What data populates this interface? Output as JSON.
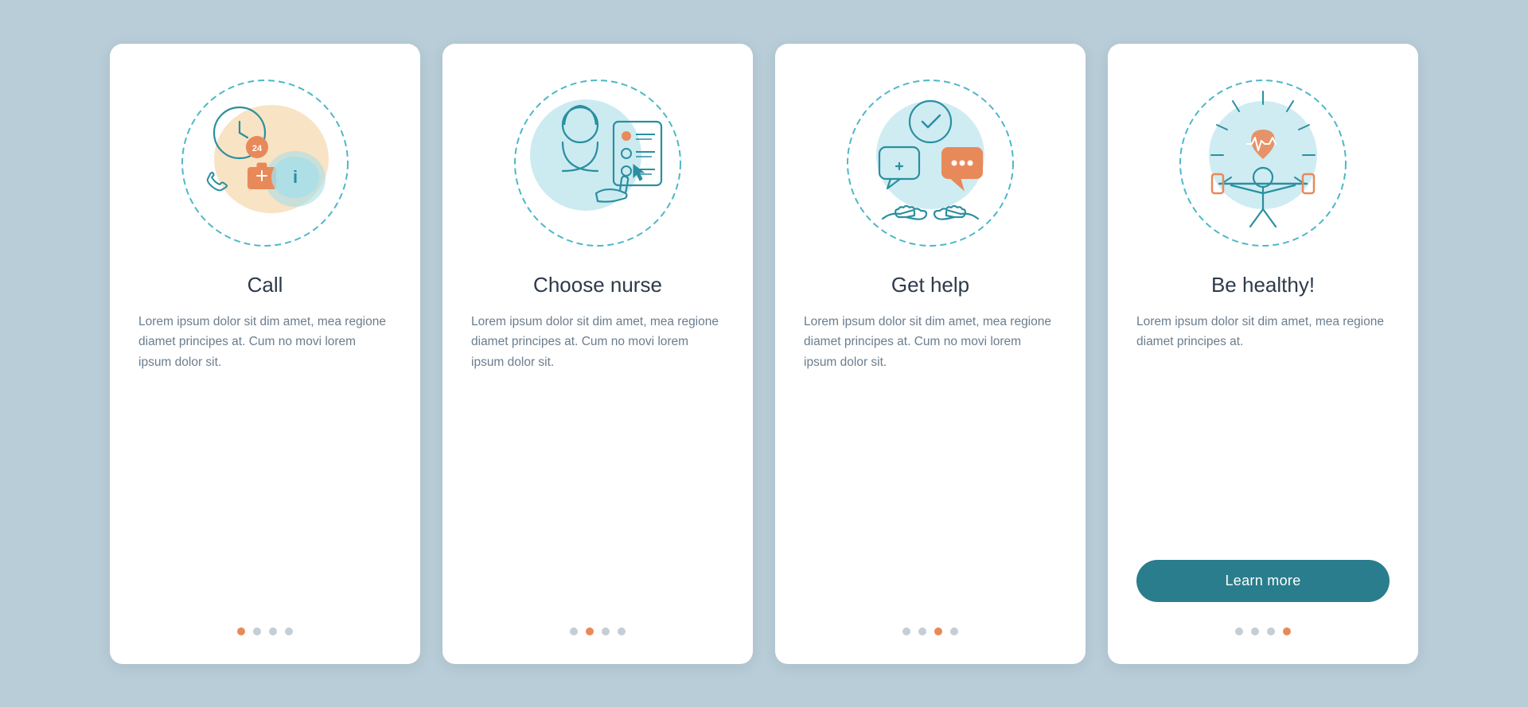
{
  "cards": [
    {
      "id": "call",
      "title": "Call",
      "text": "Lorem ipsum dolor sit dim amet, mea regione diamet principes at. Cum no movi lorem ipsum dolor sit.",
      "dots": [
        true,
        false,
        false,
        false
      ],
      "has_button": false
    },
    {
      "id": "choose-nurse",
      "title": "Choose nurse",
      "text": "Lorem ipsum dolor sit dim amet, mea regione diamet principes at. Cum no movi lorem ipsum dolor sit.",
      "dots": [
        false,
        true,
        false,
        false
      ],
      "has_button": false
    },
    {
      "id": "get-help",
      "title": "Get help",
      "text": "Lorem ipsum dolor sit dim amet, mea regione diamet principes at. Cum no movi lorem ipsum dolor sit.",
      "dots": [
        false,
        false,
        true,
        false
      ],
      "has_button": false
    },
    {
      "id": "be-healthy",
      "title": "Be healthy!",
      "text": "Lorem ipsum dolor sit dim amet, mea regione diamet principes at.",
      "dots": [
        false,
        false,
        false,
        true
      ],
      "has_button": true,
      "button_label": "Learn more"
    }
  ],
  "colors": {
    "teal": "#2a8fa0",
    "orange": "#e8895a",
    "teal_bg": "#a8dde8",
    "orange_bg": "#f5d9b0",
    "button_bg": "#2a7d8c",
    "text": "#6b7d8e",
    "title": "#2d3a4a",
    "dot_inactive": "#c5cdd6"
  }
}
